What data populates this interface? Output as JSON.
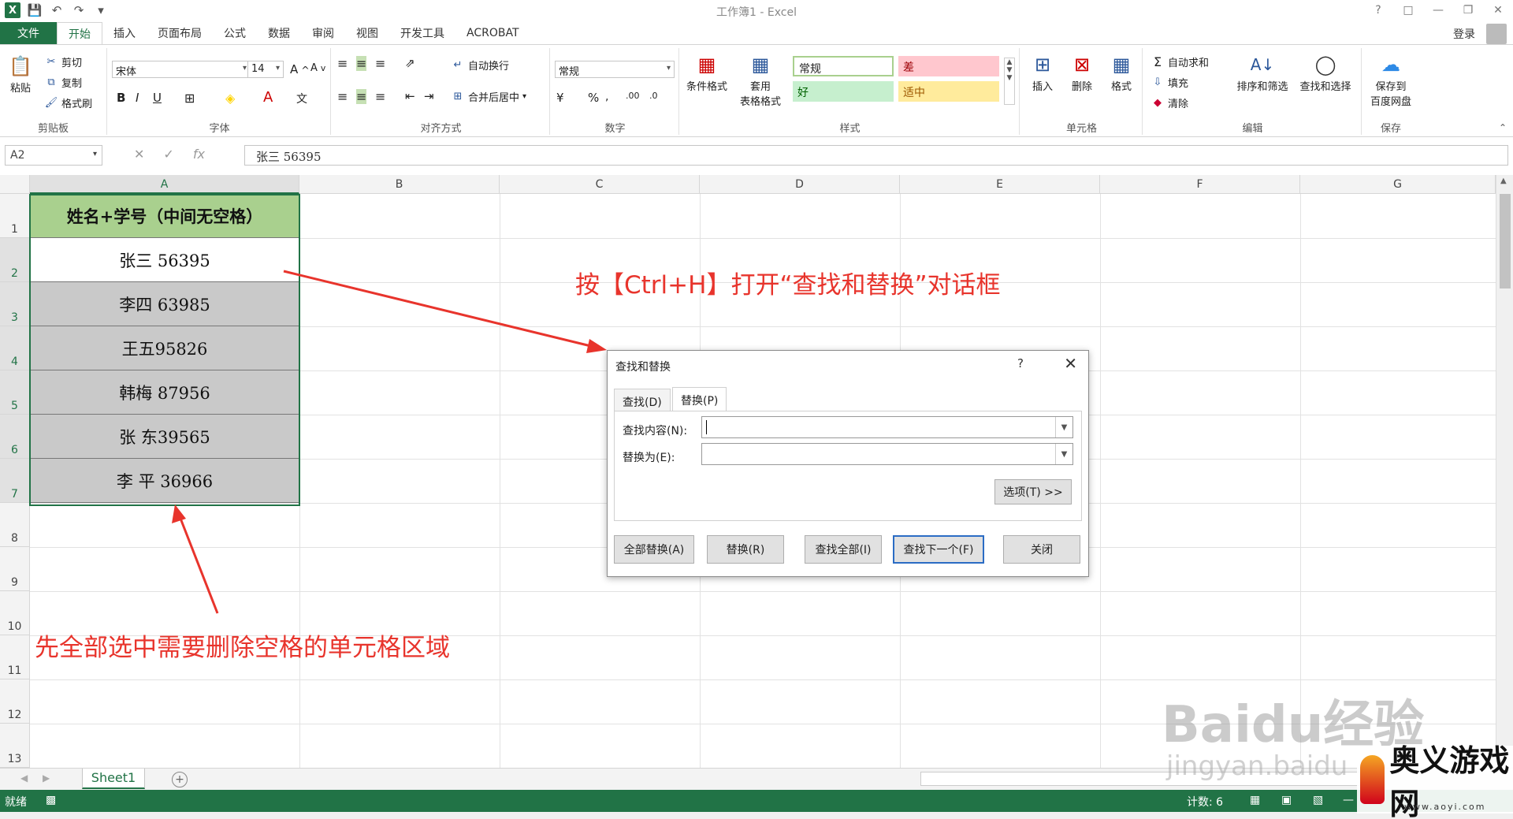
{
  "window": {
    "title": "工作簿1 - Excel",
    "login": "登录"
  },
  "tabs": [
    "文件",
    "开始",
    "插入",
    "页面布局",
    "公式",
    "数据",
    "审阅",
    "视图",
    "开发工具",
    "ACROBAT"
  ],
  "ribbon": {
    "clipboard": {
      "paste": "粘贴",
      "cut": "剪切",
      "copy": "复制",
      "format_painter": "格式刷",
      "label": "剪贴板"
    },
    "font": {
      "name": "宋体",
      "size": "14",
      "label": "字体"
    },
    "alignment": {
      "wrap": "自动换行",
      "merge": "合并后居中",
      "label": "对齐方式"
    },
    "number": {
      "format": "常规",
      "percent": "%",
      "label": "数字"
    },
    "styles": {
      "conditional": "条件格式",
      "table_l1": "套用",
      "table_l2": "表格格式",
      "normal": "常规",
      "bad": "差",
      "good": "好",
      "neutral": "适中",
      "label": "样式"
    },
    "cells": {
      "insert": "插入",
      "delete": "删除",
      "format": "格式",
      "label": "单元格"
    },
    "editing": {
      "autosum": "自动求和",
      "fill": "填充",
      "clear": "清除",
      "sort": "排序和筛选",
      "find": "查找和选择",
      "label": "编辑"
    },
    "save": {
      "line1": "保存到",
      "line2": "百度网盘",
      "label": "保存"
    },
    "colors": {
      "normal_bg": "#ffffff",
      "bad_bg": "#ffc7ce",
      "good_bg": "#c6efce",
      "neutral_bg": "#ffeb9c"
    }
  },
  "formula_bar": {
    "name_box": "A2",
    "value": "张三  56395"
  },
  "columns": [
    "A",
    "B",
    "C",
    "D",
    "E",
    "F",
    "G"
  ],
  "rows": [
    "1",
    "2",
    "3",
    "4",
    "5",
    "6",
    "7",
    "8",
    "9",
    "10",
    "11",
    "12",
    "13"
  ],
  "cells": {
    "header": "姓名+学号（中间无空格）",
    "values": [
      "张三  56395",
      "李四  63985",
      "王五95826",
      "韩梅  87956",
      "张  东39565",
      "李  平  36966"
    ]
  },
  "annotations": {
    "top": "按【Ctrl+H】打开“查找和替换”对话框",
    "bottom": "先全部选中需要删除空格的单元格区域"
  },
  "dialog": {
    "title": "查找和替换",
    "help": "?",
    "tab_find": "查找(D)",
    "tab_replace": "替换(P)",
    "find_label": "查找内容(N):",
    "replace_label": "替换为(E):",
    "find_value": "",
    "replace_value": "",
    "options": "选项(T) >>",
    "replace_all": "全部替换(A)",
    "replace": "替换(R)",
    "find_all": "查找全部(I)",
    "find_next": "查找下一个(F)",
    "close": "关闭"
  },
  "sheet": {
    "tab": "Sheet1"
  },
  "status": {
    "ready": "就绪",
    "count": "计数: 6"
  },
  "watermark": {
    "baidu": "Baidu经验",
    "jingyan": "jingyan.baidu",
    "site": "奥义游戏网",
    "site_url": "www.aoyi.com"
  }
}
